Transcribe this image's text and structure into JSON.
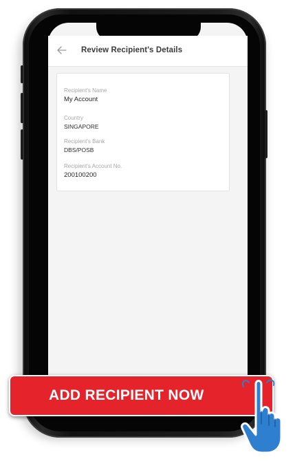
{
  "screen": {
    "title": "Review Recipient's Details",
    "back_icon": "arrow-left-icon"
  },
  "recipient": {
    "fields": [
      {
        "label": "Recipient's Name",
        "value": "My Account"
      },
      {
        "label": "Country",
        "value": "SINGAPORE"
      },
      {
        "label": "Recipient's Bank",
        "value": "DBS/POSB"
      },
      {
        "label": "Recipient's Account No.",
        "value": "200100200"
      }
    ]
  },
  "cta": {
    "label": "ADD RECIPIENT NOW",
    "color": "#e5232a"
  },
  "pointer": {
    "icon": "hand-pointer-icon",
    "color": "#2f7fd0"
  }
}
